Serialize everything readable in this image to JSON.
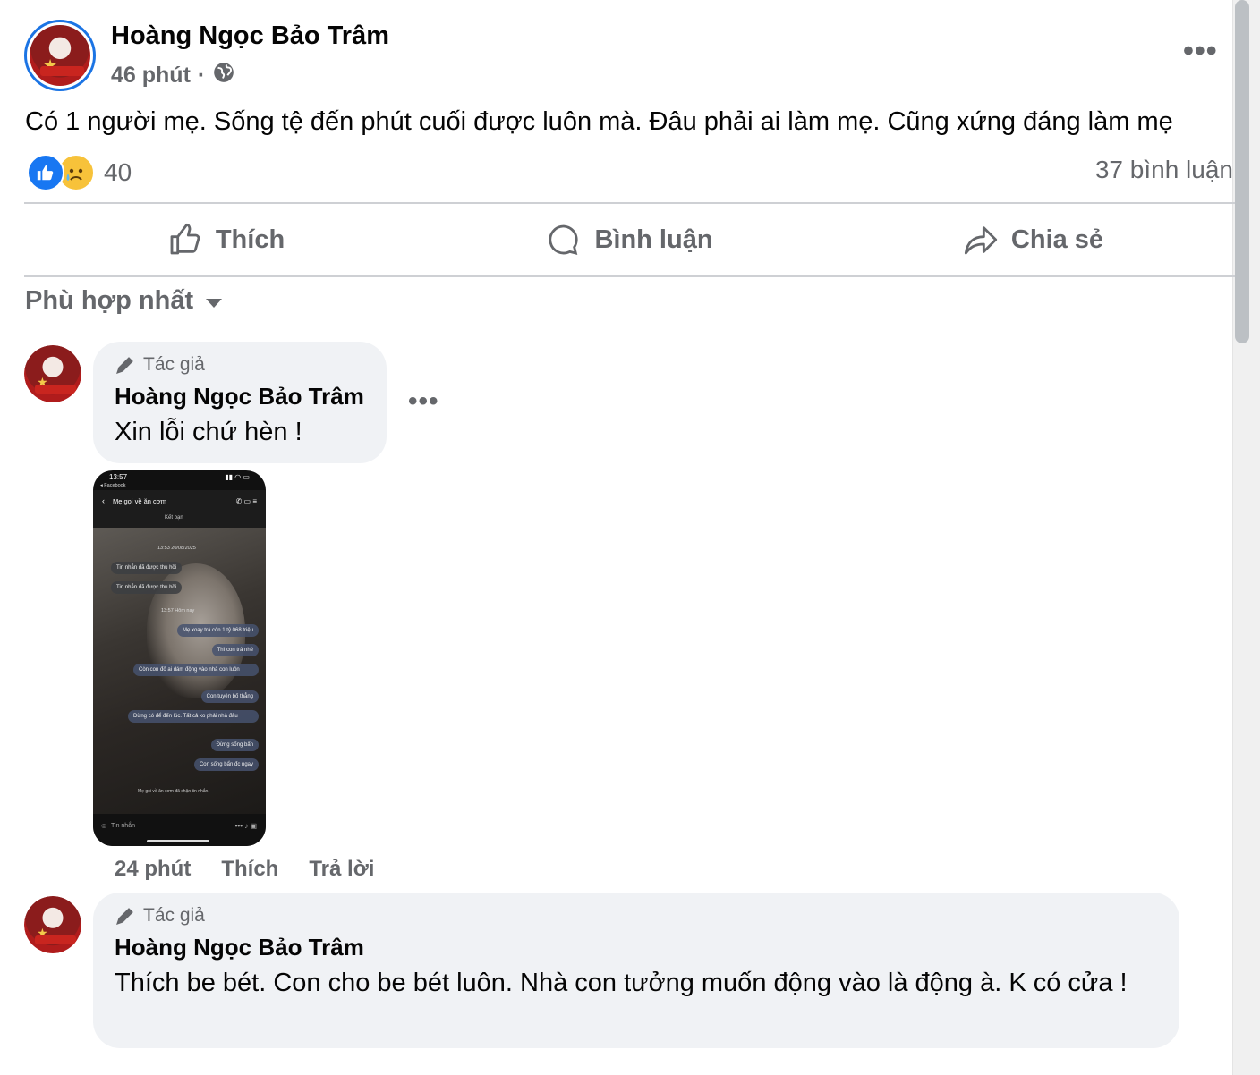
{
  "post": {
    "author": "Hoàng Ngọc Bảo Trâm",
    "time": "46 phút",
    "separator": "·",
    "text": "Có 1 người mẹ. Sống tệ đến phút cuối được luôn mà. Đâu phải ai làm mẹ. Cũng xứng đáng làm mẹ",
    "reaction_count": "40",
    "comment_count": "37 bình luận"
  },
  "actions": {
    "like": "Thích",
    "comment": "Bình luận",
    "share": "Chia sẻ"
  },
  "sort_label": "Phù hợp nhất",
  "comments": [
    {
      "author_tag": "Tác giả",
      "author": "Hoàng Ngọc Bảo Trâm",
      "text": "Xin lỗi chứ hèn !",
      "time": "24 phút",
      "like": "Thích",
      "reply": "Trả lời"
    },
    {
      "author_tag": "Tác giả",
      "author": "Hoàng Ngọc Bảo Trâm",
      "text": "Thích be bét. Con cho be bét luôn. Nhà con tưởng muốn động vào là động à. K có cửa !"
    }
  ],
  "phone": {
    "clock": "13:57",
    "back_app": "◂ Facebook",
    "chat_title": "Mẹ gọi về ăn cơm",
    "friend_label": "Kết bạn",
    "date_stamp": "13:53 20/08/2025",
    "today_stamp": "13:57 Hôm nay",
    "messages": [
      "Tin nhắn đã được thu hồi",
      "Tin nhắn đã được thu hồi",
      "Mẹ xoay trả còn 1 tỷ 068 triệu",
      "Thì con trả nhé",
      "Còn con đố ai dám động vào nhà con luôn",
      "Con tuyên bố thẳng",
      "Đừng có để đến lúc. Tất cả ko phải nhà đâu",
      "Đừng sống bẩn",
      "Con sống bẩn đc ngay"
    ],
    "blocked_notice": "Mẹ gọi về ăn cơm đã chặn tin nhắn.",
    "input_placeholder": "Tin nhắn"
  },
  "colors": {
    "accent": "#1877f2",
    "secondary_text": "#65676b",
    "bubble": "#f0f2f5"
  }
}
